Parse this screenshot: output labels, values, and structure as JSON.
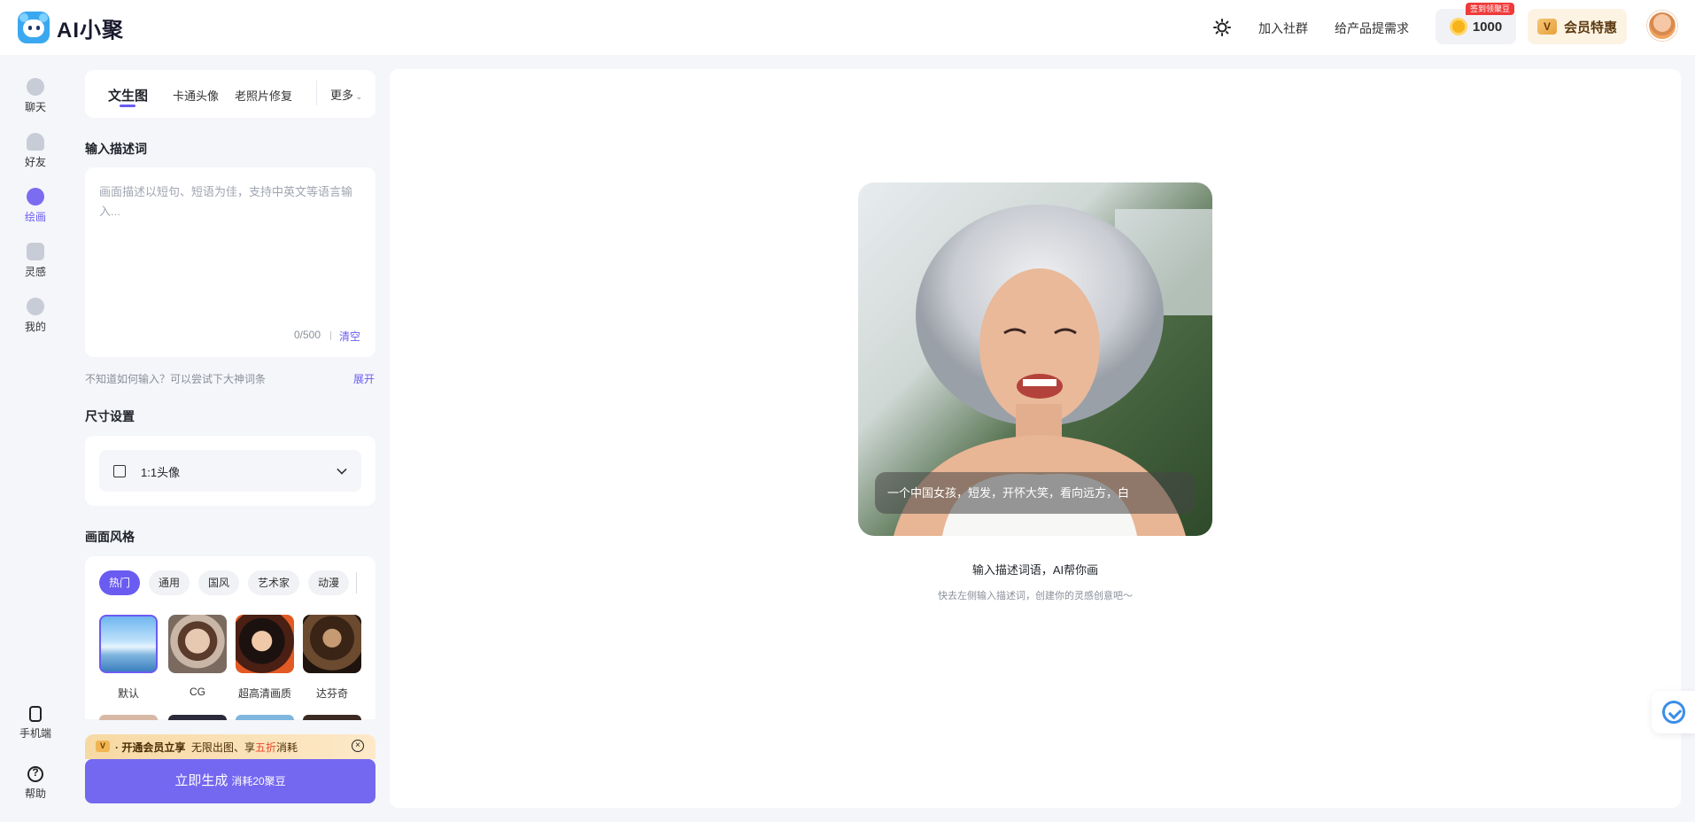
{
  "header": {
    "brand": "AI小聚",
    "links": [
      "加入社群",
      "给产品提需求"
    ],
    "coins": "1000",
    "coin_badge": "签到领聚豆",
    "vip_label": "会员特惠",
    "vip_mark": "V"
  },
  "nav": {
    "items": [
      {
        "label": "聊天",
        "icon": "chat-icon"
      },
      {
        "label": "好友",
        "icon": "friend-icon"
      },
      {
        "label": "绘画",
        "icon": "paint-icon"
      },
      {
        "label": "灵感",
        "icon": "inspiration-icon"
      },
      {
        "label": "我的",
        "icon": "profile-icon"
      }
    ],
    "bottom": [
      {
        "label": "手机端",
        "icon": "phone-icon"
      },
      {
        "label": "帮助",
        "icon": "help-icon"
      }
    ]
  },
  "panel": {
    "tabs": [
      "文生图",
      "卡通头像",
      "老照片修复"
    ],
    "more": "更多",
    "prompt_title": "输入描述词",
    "prompt_placeholder": "画面描述以短句、短语为佳，支持中英文等语言输入...",
    "prompt_count": "0/500",
    "prompt_clear": "清空",
    "hint": "不知道如何输入？可以尝试下大神词条",
    "hint_expand": "展开",
    "size_title": "尺寸设置",
    "size_value": "1:1头像",
    "style_title": "画面风格",
    "style_chips": [
      "热门",
      "通用",
      "国风",
      "艺术家",
      "动漫"
    ],
    "styles": [
      "默认",
      "CG",
      "超高清画质",
      "达芬奇"
    ],
    "promo_prefix": "· 开通会员立享",
    "promo_mid": "无限出图、享",
    "promo_hl": "五折",
    "promo_suffix": "消耗",
    "generate": "立即生成",
    "generate_cost": "消耗20聚豆"
  },
  "canvas": {
    "caption": "一个中国女孩，短发，开怀大笑，看向远方，白",
    "title": "输入描述词语，AI帮你画",
    "subtitle": "快去左侧输入描述词，创建你的灵感创意吧～"
  },
  "colors": {
    "accent": "#6a5cf0",
    "button": "#7467f0",
    "coin": "#f6b41a",
    "vip_bg": "#fdf3e3"
  }
}
